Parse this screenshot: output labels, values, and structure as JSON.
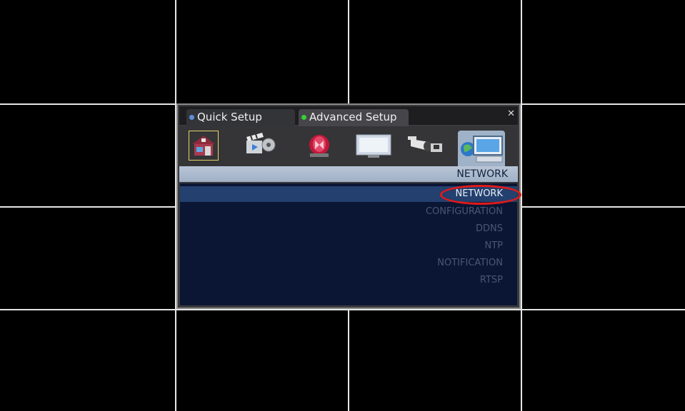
{
  "tabs": {
    "quick_setup": "Quick Setup",
    "advanced_setup": "Advanced Setup"
  },
  "icons": [
    "home-icon",
    "clapperboard-icon",
    "alarm-light-icon",
    "monitor-icon",
    "camera-icon",
    "network-computer-icon"
  ],
  "section_title": "NETWORK",
  "menu": {
    "items": [
      "NETWORK",
      "CONFIGURATION",
      "DDNS",
      "NTP",
      "NOTIFICATION",
      "RTSP"
    ],
    "selected": "NETWORK"
  },
  "colors": {
    "quick_dot": "#5e8fd8",
    "advanced_dot": "#35d037",
    "annotation": "#e11a1a"
  }
}
